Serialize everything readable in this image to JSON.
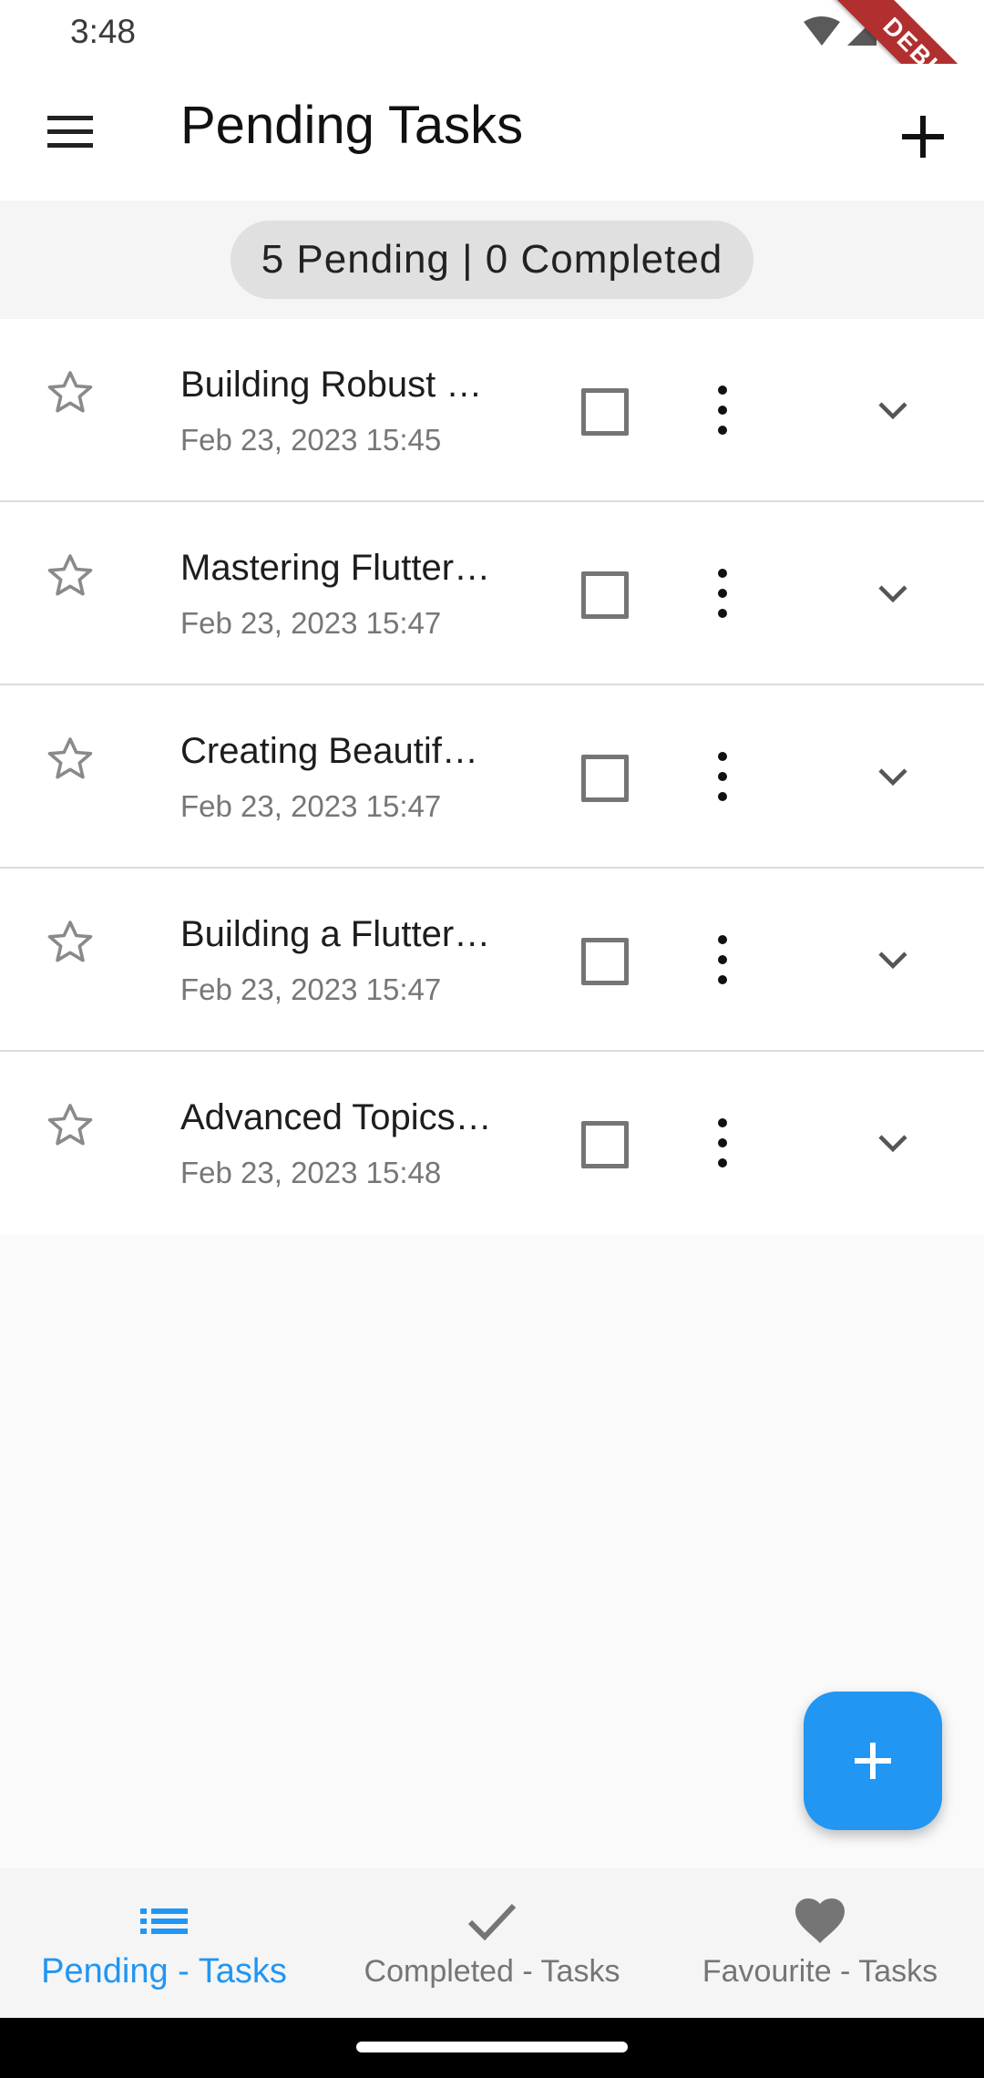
{
  "status_bar": {
    "time": "3:48"
  },
  "debug_banner": "DEBUG",
  "app_bar": {
    "title": "Pending Tasks",
    "menu_icon": "hamburger-menu-icon",
    "add_icon": "plus-icon"
  },
  "summary": {
    "text": "5 Pending | 0 Completed"
  },
  "tasks": [
    {
      "title": "Building Robust …",
      "date": "Feb 23, 2023 15:45",
      "favourite": false,
      "completed": false
    },
    {
      "title": "Mastering Flutter…",
      "date": "Feb 23, 2023 15:47",
      "favourite": false,
      "completed": false
    },
    {
      "title": "Creating Beautif…",
      "date": "Feb 23, 2023 15:47",
      "favourite": false,
      "completed": false
    },
    {
      "title": "Building a Flutter…",
      "date": "Feb 23, 2023 15:47",
      "favourite": false,
      "completed": false
    },
    {
      "title": "Advanced Topics…",
      "date": "Feb 23, 2023 15:48",
      "favourite": false,
      "completed": false
    }
  ],
  "fab": {
    "icon": "plus-icon",
    "color": "#2196f3"
  },
  "bottom_nav": {
    "items": [
      {
        "label": "Pending - Tasks",
        "icon": "list-icon",
        "active": true
      },
      {
        "label": "Completed - Tasks",
        "icon": "check-icon",
        "active": false
      },
      {
        "label": "Favourite - Tasks",
        "icon": "heart-icon",
        "active": false
      }
    ]
  },
  "colors": {
    "accent": "#2196f3",
    "debug": "#b22f2f",
    "inactive": "#757575"
  }
}
